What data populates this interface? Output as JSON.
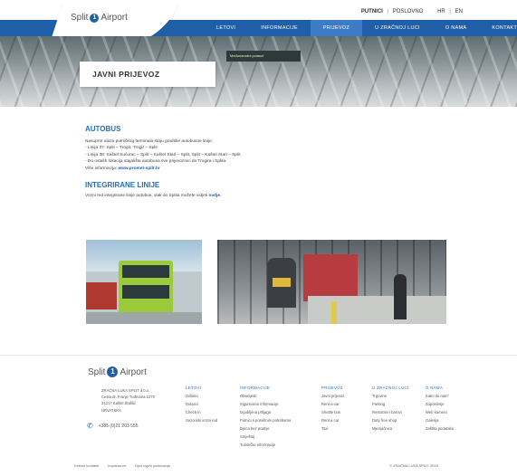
{
  "header": {
    "logo_text": "Split",
    "logo_text2": "Airport",
    "top_links": [
      "PUTNICI",
      "POSLOVNO"
    ],
    "lang": [
      "HR",
      "EN"
    ],
    "nav": [
      {
        "label": "LETOVI",
        "active": false
      },
      {
        "label": "INFORMACIJE",
        "active": false
      },
      {
        "label": "PRIJEVOZ",
        "active": true
      },
      {
        "label": "U ZRAČNOJ LUCI",
        "active": false
      },
      {
        "label": "O NAMA",
        "active": false
      },
      {
        "label": "KONTAKT",
        "active": false
      }
    ]
  },
  "hero": {
    "sign": "Međunarodni polasci",
    "title": "JAVNI PRIJEVOZ"
  },
  "main": {
    "h1": "AUTOBUS",
    "intro": "Nasuprot ulaza putničkog terminala staju gradske autobusne linije:",
    "lines": [
      "- Linija 37: Split – Trogir, Trogir – Split",
      "- Linija 38: Kaštel Sućurac – Split – Kaštel Stari – Split, Split – Kaštel Stari – Split",
      "- Do ostalih lokacija stajališta autobusa sve prijevoznici do Trogira i Splita."
    ],
    "more_prefix": "Više informacija:",
    "more_link": "www.promet-split.hr",
    "h2": "INTEGRIRANE LINIJE",
    "integr_text": "Vozni red integrirane linije autobus, vlak do Splita možete vidjeti",
    "integr_link": "ovdje."
  },
  "footer": {
    "logo_text": "Split",
    "logo_text2": "Airport",
    "address": [
      "ZRAČNA LUKA SPLIT d.o.o.",
      "Cesta dr. Franje Tuđmana 1270",
      "21217 Kaštel Štafilić",
      "HRVATSKA"
    ],
    "phone": "+385 (0)21 203 555",
    "columns": [
      {
        "head": "LETOVI",
        "items": [
          "Odlasci",
          "Dolasci",
          "Check-in",
          "Sezonski vozni red"
        ]
      },
      {
        "head": "INFORMACIJE",
        "items": [
          "Obavijesti",
          "Sigurnosne informacije",
          "Izgubljena prtljaga",
          "Putnici s posebnim potrebama",
          "Djeca bez pratnje",
          "Smještaj",
          "Turističke informacije"
        ]
      },
      {
        "head": "PRIJEVOZ",
        "items": [
          "Javni prijevoz",
          "Rent-a-car",
          "Shuttle bus",
          "Rent a car",
          "Taxi"
        ]
      },
      {
        "head": "U ZRAČNOJ LUCI",
        "items": [
          "Trgovine",
          "Parking",
          "Restorani i barovi",
          "Duty free shop",
          "Mjenjačnica"
        ]
      },
      {
        "head": "O NAMA",
        "items": [
          "Kako do nas?",
          "Zaposlenje",
          "Web kamera",
          "Galerija",
          "Zaštita podataka"
        ]
      }
    ],
    "bottom_links": [
      "Korisni kontakti",
      "Impressum",
      "Opći uvjeti poslovanja"
    ],
    "copyright": "© ZRAČNA LUKA SPLIT 2016"
  }
}
